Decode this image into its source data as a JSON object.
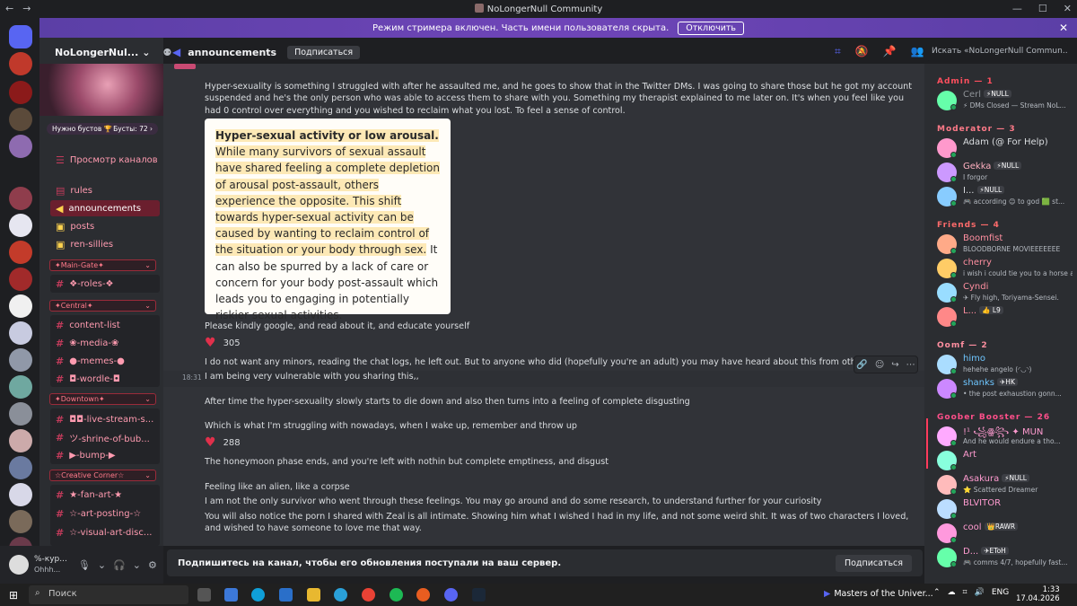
{
  "window": {
    "title": "NoLongerNull Community",
    "back": "←",
    "forward": "→",
    "minimize": "—",
    "maximize": "☐",
    "close": "✕"
  },
  "banner": {
    "text": "Режим стримера включен. Часть имени пользователя скрыта.",
    "button": "Отключить",
    "close": "✕"
  },
  "server": {
    "name": "NoLongerNul...",
    "boost_left": "Нужно бустов 🏆",
    "boost_right": "Бусты: 72 ›",
    "browse": "Просмотр каналов"
  },
  "channels_top": [
    {
      "label": "rules",
      "selected": false
    },
    {
      "label": "announcements",
      "selected": true
    },
    {
      "label": "posts",
      "selected": false
    },
    {
      "label": "ren-sillies",
      "selected": false
    }
  ],
  "categories": [
    {
      "label": "✦Main-Gate✦",
      "channels": [
        "❖-roles-❖"
      ]
    },
    {
      "label": "✦Central✦",
      "channels": [
        "content-list",
        "❀-media-❀",
        "●-memes-●",
        "◘-wordle-◘"
      ]
    },
    {
      "label": "✦Downtown✦",
      "channels": [
        "◘◘-live-stream-s...",
        "ツ-shrine-of-bub...",
        "▶-bump-▶"
      ]
    },
    {
      "label": "☆Creative Corner☆",
      "channels": [
        "★-fan-art-★",
        "☆-art-posting-☆",
        "☆-visual-art-disc..."
      ]
    }
  ],
  "user": {
    "name": "%-кур...",
    "status": "Ohhh..."
  },
  "chat_header": {
    "channel": "announcements",
    "subscribe": "Подписаться",
    "search_placeholder": "Искать «NoLongerNull Commun..."
  },
  "messages": [
    {
      "text": "Hyper-sexuality is something I struggled with after he assaulted me, and he goes to show that in the Twitter DMs. I was going to share those but he got my account suspended and he's the only person who was able to access them to share with you. Something my therapist explained to me later on. It's when you feel like you had 0 control over everything and you wished to reclaim what you lost. To feel a sense of control."
    },
    {
      "text": "Please kindly google, and read about it, and educate yourself"
    },
    {
      "text": "I do not want any minors, reading the chat logs, he left out. But to anyone who did (hopefully you're an adult) you may have heard about this from other survivors"
    },
    {
      "text": "I am being very vulnerable with you sharing this,,"
    },
    {
      "text": "After time the hyper-sexuality slowly starts to die down and also then turns into a feeling of complete disgusting"
    },
    {
      "text": "Which is what I'm struggling with nowadays, when I wake up, remember and throw up"
    },
    {
      "text": "The honeymoon phase ends, and you're left with nothin but complete emptiness, and disgust"
    },
    {
      "text": "Feeling like an alien, like a corpse"
    },
    {
      "text": "I am not the only survivor who went through these feelings. You may go around and do some research, to understand further for your curiosity"
    },
    {
      "text": "You will also notice the porn I shared with Zeal is all intimate. Showing him what I wished I had in my life, and not some weird shit. It was of two characters I loved, and wished to have someone to love me that way."
    }
  ],
  "card": {
    "bold": "Hyper-sexual activity or low arousal.",
    "highlight": " While many survivors of sexual assault have shared feeling a complete depletion of arousal post-assault, others experience the opposite. This shift towards hyper-sexual activity can be caused by wanting to reclaim control of the situation or your body through sex.",
    "rest": " It can also be spurred by a lack of care or concern for your body post-assault which leads you to engaging in potentially riskier sexual activities."
  },
  "reactions": [
    {
      "emoji": "♥",
      "count": "305"
    },
    {
      "emoji": "♥",
      "count": "288"
    }
  ],
  "timestamp": "18:31",
  "footer": {
    "text": "Подпишитесь на канал, чтобы его обновления поступали на ваш сервер.",
    "button": "Подписаться"
  },
  "member_groups": [
    {
      "label": "Admin — 1",
      "color": "#ff4f5e",
      "members": [
        {
          "name": "Cerl",
          "tag": "⚡NULL",
          "status": "⚡ DMs Closed — Stream NoL...",
          "color": "#8e9297"
        }
      ]
    },
    {
      "label": "Moderator — 3",
      "color": "#ff7a88",
      "members": [
        {
          "name": "Adam (@ For Help)",
          "tag": "",
          "status": "",
          "color": "#dbdee1"
        },
        {
          "name": "Gekka",
          "tag": "⚡NULL",
          "status": "I forgor",
          "color": "#ffb0c0"
        },
        {
          "name": "I...",
          "tag": "⚡NULL",
          "status": "🎮 according 😊 to god 🟩 st...",
          "color": "#dbdee1"
        }
      ]
    },
    {
      "label": "Friends — 4",
      "color": "#ff6b6b",
      "members": [
        {
          "name": "Boomfist",
          "tag": "",
          "status": "BLOODBORNE MOVIEEEEEEE",
          "color": "#ff8fa0"
        },
        {
          "name": "cherry",
          "tag": "",
          "status": "i wish i could tie you to a horse and...",
          "color": "#ff8fa0"
        },
        {
          "name": "Cyndi",
          "tag": "",
          "status": "✈ Fly high, Toriyama-Sensei.",
          "color": "#ff8fa0"
        },
        {
          "name": "L...",
          "tag": "👍 L9",
          "status": "",
          "color": "#ff8fa0"
        }
      ]
    },
    {
      "label": "Oomf — 2",
      "color": "#ff8fa0",
      "members": [
        {
          "name": "himo",
          "tag": "",
          "status": "hehehe angelo (◜◡◝)",
          "color": "#6ec6ff"
        },
        {
          "name": "shanks",
          "tag": "✈HK",
          "status": "• the post exhaustion gonn...",
          "color": "#6ec6ff"
        }
      ]
    },
    {
      "label": "Goober Booster — 26",
      "color": "#ff4f8a",
      "members": [
        {
          "name": "!¹ ꧁ꙮ꧂ ✦ MUN",
          "tag": "",
          "status": "And he would endure a tho...",
          "color": "#ff9bd0"
        },
        {
          "name": "Art",
          "tag": "",
          "status": "",
          "color": "#ff9bd0"
        },
        {
          "name": "Asakura",
          "tag": "⚡NULL",
          "status": "⭐ Scattered Dreamer",
          "color": "#ff9bd0"
        },
        {
          "name": "BLVITOR",
          "tag": "",
          "status": "",
          "color": "#ff9bd0"
        },
        {
          "name": "cool",
          "tag": "👑RAWR",
          "status": "",
          "color": "#ff9bd0"
        },
        {
          "name": "D...",
          "tag": "✈EToH",
          "status": "🎮 comms 4/7, hopefully fast...",
          "color": "#ff9bd0"
        }
      ]
    }
  ],
  "taskbar": {
    "search": "Поиск",
    "media": "Masters of the Univer...",
    "lang": "ENG",
    "time": "1:33",
    "date": "17.04.2026"
  }
}
